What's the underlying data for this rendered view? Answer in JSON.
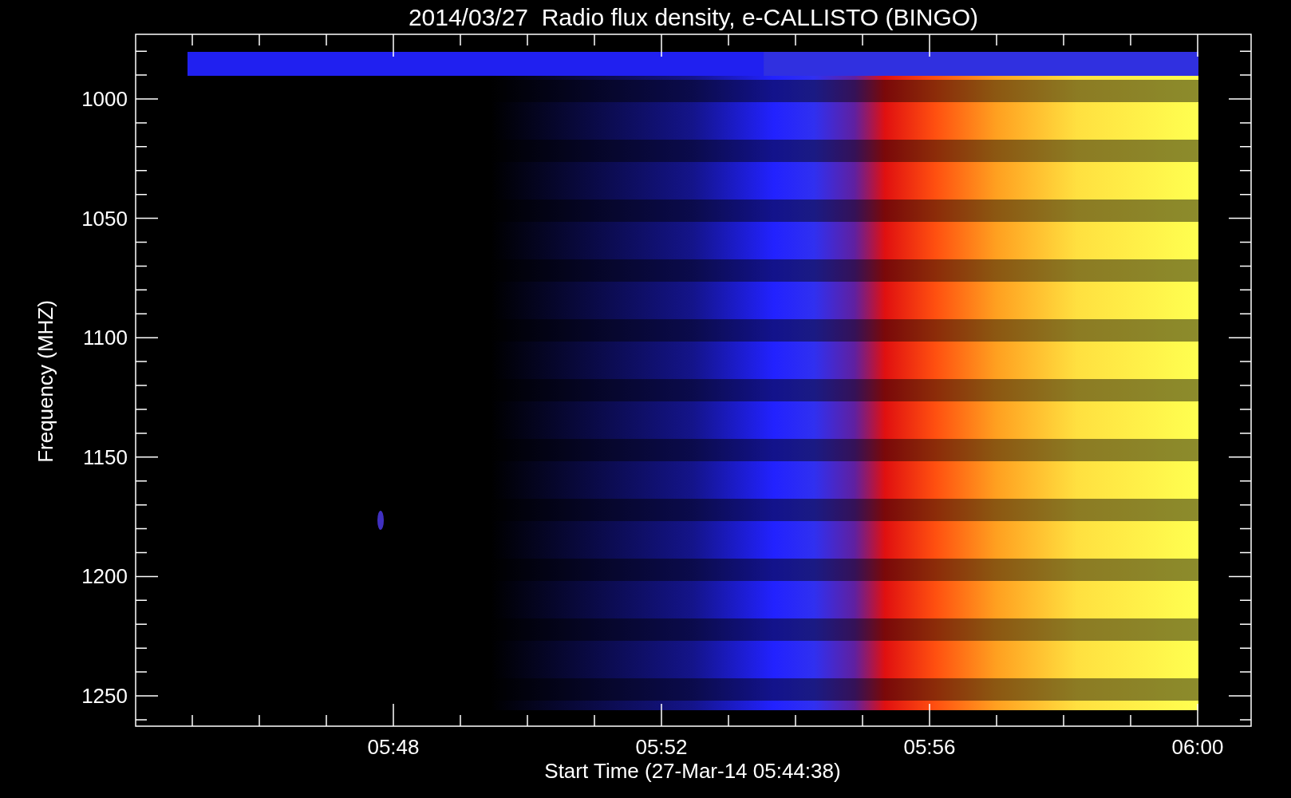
{
  "title": "2014/03/27  Radio flux density, e-CALLISTO (BINGO)",
  "y_axis": {
    "label": "Frequency (MHZ)",
    "ticks": [
      "1000",
      "1050",
      "1100",
      "1150",
      "1200",
      "1250"
    ]
  },
  "x_axis": {
    "label": "Start Time (27-Mar-14 05:44:38)",
    "ticks": [
      "05:48",
      "05:52",
      "05:56",
      "06:00"
    ]
  }
}
